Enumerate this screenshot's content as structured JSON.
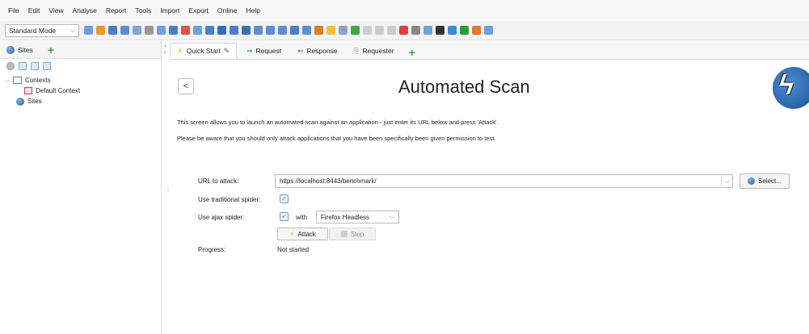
{
  "menu": [
    "File",
    "Edit",
    "View",
    "Analyse",
    "Report",
    "Tools",
    "Import",
    "Export",
    "Online",
    "Help"
  ],
  "toolbar": {
    "mode": "Standard Mode",
    "icon_colors": [
      "#6fa0d8",
      "#e49a2b",
      "#4b7fc0",
      "#5b8fd0",
      "#7aa6d6",
      "#999999",
      "#6fa0d8",
      "#4b7fc0",
      "#d9534f",
      "#6fa0d8",
      "#4b7fc0",
      "#2f6fc0",
      "#4b7fc0",
      "#3a6fb0",
      "#5b8fd0",
      "#5b8fd0",
      "#5b8fd0",
      "#4b7fc0",
      "#5b8fd0",
      "#e07b2b",
      "#f0c23a",
      "#8aa4c8",
      "#39a843",
      "#cccccc",
      "#cccccc",
      "#cccccc",
      "#e04040",
      "#888888",
      "#6fa0d8",
      "#333333",
      "#3a8ad8",
      "#2d9a3a",
      "#e07b2b",
      "#6fa0d8"
    ]
  },
  "left_panel": {
    "tab_label": "Sites",
    "tree": {
      "contexts_label": "Contexts",
      "default_context_label": "Default Context",
      "sites_label": "Sites"
    }
  },
  "right_tabs": [
    {
      "label": "Quick Start",
      "icon": "bolt-icon",
      "active": true
    },
    {
      "label": "Request",
      "icon": "arrow-right-icon",
      "active": false
    },
    {
      "label": "Response",
      "icon": "arrow-left-icon",
      "active": false
    },
    {
      "label": "Requester",
      "icon": "requester-icon",
      "active": false
    }
  ],
  "main": {
    "back_label": "<",
    "title": "Automated Scan",
    "description_1": "This screen allows you to launch an automated scan against  an application - just enter its URL below and press 'Attack'.",
    "description_2": "Please be aware that you should only attack applications that you have been specifically been given permission to test.",
    "url_label": "URL to attack:",
    "url_value": "https://localhost:8443/benchmark/",
    "select_label": "Select...",
    "traditional_spider_label": "Use traditional spider:",
    "ajax_spider_label": "Use ajax spider:",
    "with_label": "with",
    "browser_value": "Firefox Headless",
    "attack_label": "Attack",
    "stop_label": "Stop",
    "progress_label": "Progress:",
    "progress_value": "Not started"
  }
}
